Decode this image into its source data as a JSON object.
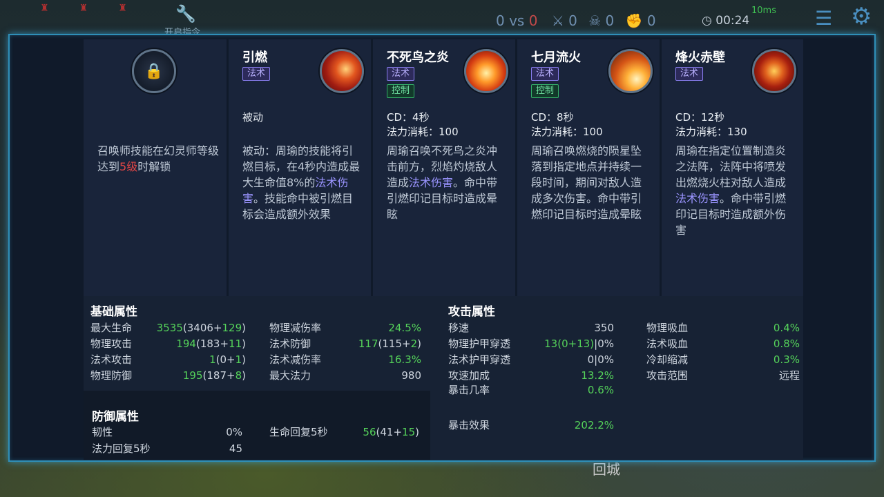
{
  "hud": {
    "command_label": "开启指令",
    "score_blue": "0",
    "vs": "vs",
    "score_red": "0",
    "kills": "0",
    "deaths": "0",
    "assists": "0",
    "time": "00:24",
    "signal": "10ms",
    "back_label": "回城"
  },
  "skills": {
    "locked": {
      "icon": "lock-icon",
      "text_before": "召唤师技能在幻灵师等级达到",
      "level": "5级",
      "text_after": "时解锁"
    },
    "list": [
      {
        "name": "引燃",
        "icon": "ignite-icon",
        "tags": [
          "法术"
        ],
        "meta1": "被动",
        "meta2": "",
        "desc_before": "被动：周瑜的技能将引燃目标，在4秒内造成最大生命值8%的",
        "desc_hl": "法术伤害",
        "desc_after": "。技能命中被引燃目标会造成额外效果"
      },
      {
        "name": "不死鸟之炎",
        "icon": "phoenix-icon",
        "tags": [
          "法术",
          "控制"
        ],
        "meta1": "CD：4秒",
        "meta2": "法力消耗：100",
        "desc_before": "周瑜召唤不死鸟之炎冲击前方，烈焰灼烧敌人造成",
        "desc_hl": "法术伤害",
        "desc_after": "。命中带引燃印记目标时造成晕眩"
      },
      {
        "name": "七月流火",
        "icon": "meteor-icon",
        "tags": [
          "法术",
          "控制"
        ],
        "meta1": "CD：8秒",
        "meta2": "法力消耗：100",
        "desc_before": "周瑜召唤燃烧的陨星坠落到指定地点并持续一段时间，期间对敌人造成多次伤害。命中带引燃印记目标时造成晕眩",
        "desc_hl": "",
        "desc_after": ""
      },
      {
        "name": "烽火赤壁",
        "icon": "fire-wall-icon",
        "tags": [
          "法术"
        ],
        "meta1": "CD：12秒",
        "meta2": "法力消耗：130",
        "desc_before": "周瑜在指定位置制造炎之法阵，法阵中将喷发出燃烧火柱对敌人造成",
        "desc_hl": "法术伤害",
        "desc_after": "。命中带引燃印记目标时造成额外伤害"
      }
    ]
  },
  "basic": {
    "title": "基础属性",
    "left": [
      {
        "label": "最大生命",
        "total": "3535",
        "base": "3406",
        "bonus": "129"
      },
      {
        "label": "物理攻击",
        "total": "194",
        "base": "183",
        "bonus": "11"
      },
      {
        "label": "法术攻击",
        "total": "1",
        "base": "0",
        "bonus": "1"
      },
      {
        "label": "物理防御",
        "total": "195",
        "base": "187",
        "bonus": "8"
      }
    ],
    "right": [
      {
        "label": "物理减伤率",
        "value": "24.5%"
      },
      {
        "label": "法术防御",
        "total": "117",
        "base": "115",
        "bonus": "2"
      },
      {
        "label": "法术减伤率",
        "value": "16.3%"
      },
      {
        "label": "最大法力",
        "value": "980"
      }
    ]
  },
  "defense": {
    "title": "防御属性",
    "items": [
      {
        "label": "韧性",
        "value": "0%"
      },
      {
        "label": "生命回复5秒",
        "total": "56",
        "base": "41",
        "bonus": "15"
      },
      {
        "label": "法力回复5秒",
        "value": "45"
      }
    ]
  },
  "attack": {
    "title": "攻击属性",
    "left": [
      {
        "label": "移速",
        "value": "350"
      },
      {
        "label": "物理护甲穿透",
        "value_green": "13(0+13)",
        "value_rest": "|0%"
      },
      {
        "label": "法术护甲穿透",
        "value_green": "",
        "value_rest": "0|0%"
      },
      {
        "label": "攻速加成",
        "value": "13.2%"
      },
      {
        "label": "暴击几率",
        "value": "0.6%"
      },
      {
        "label": "暴击效果",
        "value": "202.2%"
      }
    ],
    "right": [
      {
        "label": "物理吸血",
        "value": "0.4%"
      },
      {
        "label": "法术吸血",
        "value": "0.8%"
      },
      {
        "label": "冷却缩减",
        "value": "0.3%"
      },
      {
        "label": "攻击范围",
        "value": "远程"
      }
    ]
  }
}
